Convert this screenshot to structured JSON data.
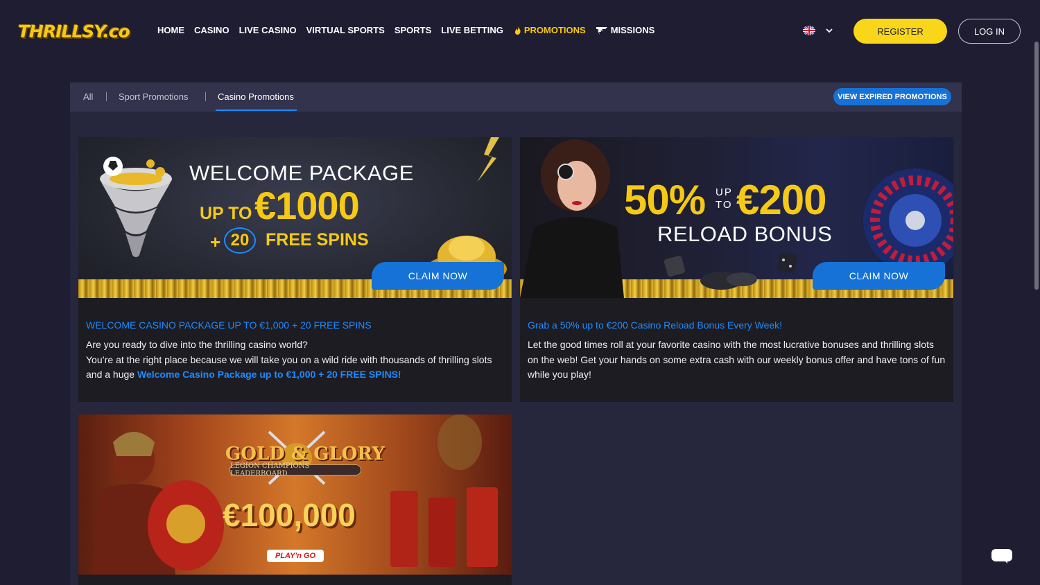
{
  "header": {
    "logo_text": "THRILLSY.co",
    "nav": [
      {
        "label": "HOME"
      },
      {
        "label": "CASINO"
      },
      {
        "label": "LIVE CASINO"
      },
      {
        "label": "VIRTUAL SPORTS"
      },
      {
        "label": "SPORTS"
      },
      {
        "label": "LIVE BETTING"
      },
      {
        "label": "PROMOTIONS",
        "icon": "flame-icon",
        "active": true
      },
      {
        "label": "MISSIONS",
        "icon": "missions-icon"
      }
    ],
    "language_icon": "uk-flag-icon",
    "register_label": "REGISTER",
    "login_label": "LOG IN"
  },
  "tabs": {
    "items": [
      {
        "label": "All"
      },
      {
        "label": "Sport Promotions"
      },
      {
        "label": "Casino Promotions",
        "active": true
      }
    ],
    "expired_label": "VIEW EXPIRED PROMOTIONS"
  },
  "promotions": [
    {
      "banner": {
        "line1": "WELCOME PACKAGE",
        "upto": "UP TO",
        "amount": "€1000",
        "plus": "+",
        "spins_num": "20",
        "spins_label": "FREE SPINS",
        "claim_label": "CLAIM NOW"
      },
      "title": "WELCOME CASINO PACKAGE UP TO €1,000 + 20 FREE SPINS",
      "desc_1": "Are you ready to dive into the thrilling casino world?",
      "desc_2": "You’re at the right place because we will take you on a wild ride with thousands of thrilling slots and a huge ",
      "desc_highlight": "Welcome Casino Package up to €1,000 + 20 FREE SPINS!"
    },
    {
      "banner": {
        "percent": "50%",
        "up": "UP",
        "to": "TO",
        "amount": "€200",
        "subtitle": "RELOAD BONUS",
        "claim_label": "CLAIM NOW"
      },
      "title": "Grab a 50% up to €200 Casino Reload Bonus Every Week!",
      "desc": "Let the good times roll at your favorite casino with the most lucrative bonuses and thrilling slots on the web! Get your hands on some extra cash with our weekly bonus offer and have tons of fun while you play!"
    },
    {
      "banner": {
        "title": "GOLD & GLORY",
        "subtitle": "LEGION CHAMPIONS LEADERBOARD",
        "amount": "€100,000",
        "provider": "PLAY'n GO"
      }
    }
  ],
  "colors": {
    "accent_yellow": "#fad61b",
    "accent_blue": "#1672d6",
    "link_blue": "#1e8bff",
    "background": "#1e1d31"
  }
}
